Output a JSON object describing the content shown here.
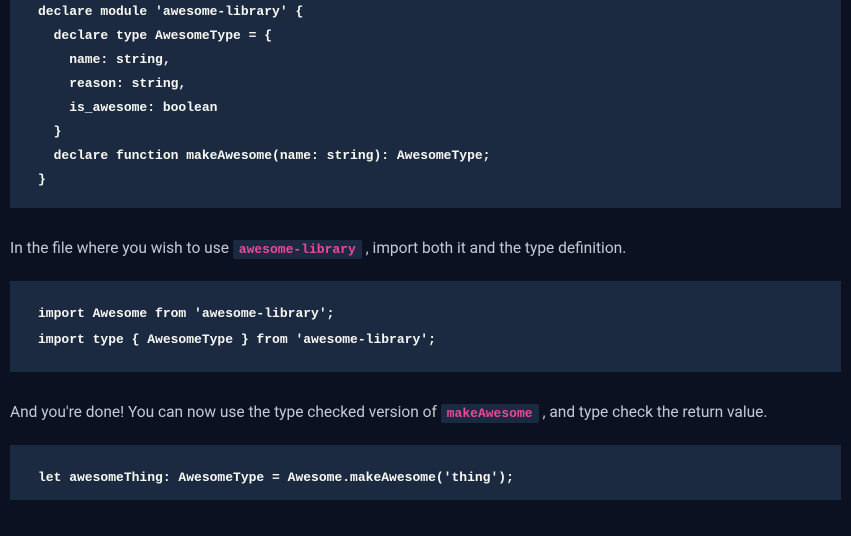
{
  "code1": "declare module 'awesome-library' {\n  declare type AwesomeType = {\n    name: string,\n    reason: string,\n    is_awesome: boolean\n  }\n  declare function makeAwesome(name: string): AwesomeType;\n}",
  "prose1_a": "In the file where you wish to use ",
  "inline1": "awesome-library",
  "prose1_b": " , import both it and the type definition.",
  "code2": "import Awesome from 'awesome-library';\nimport type { AwesomeType } from 'awesome-library';",
  "prose2_a": "And you're done! You can now use the type checked version of ",
  "inline2": "makeAwesome",
  "prose2_b": " , and type check the return value.",
  "code3": "let awesomeThing: AwesomeType = Awesome.makeAwesome('thing');"
}
